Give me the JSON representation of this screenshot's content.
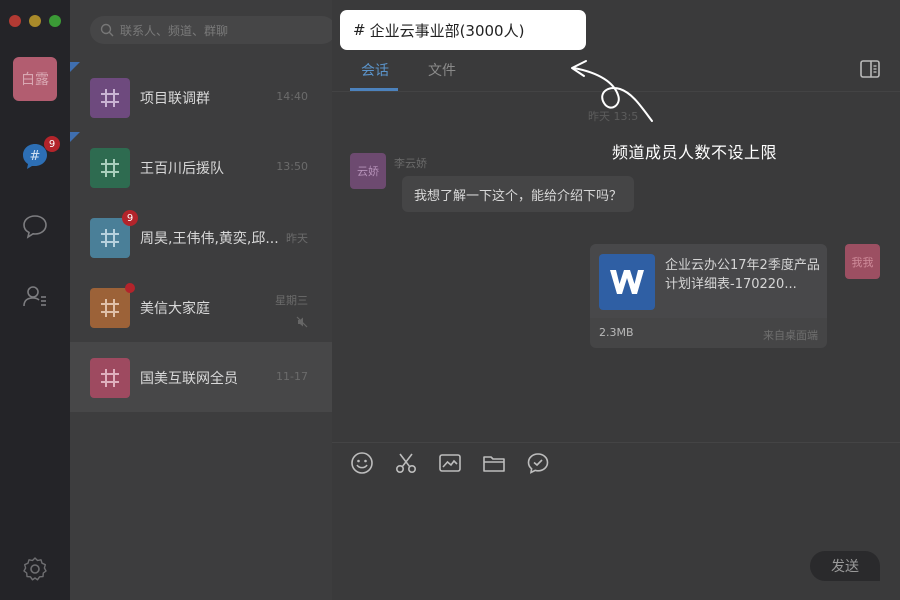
{
  "rail": {
    "user_avatar_text": "白露",
    "channel_badge": "9",
    "icons": [
      "channel-icon",
      "chat-bubble-icon",
      "contacts-icon",
      "settings-icon"
    ]
  },
  "search": {
    "placeholder": "联系人、频道、群聊"
  },
  "conversations": [
    {
      "name": "项目联调群",
      "time": "14:40",
      "color": "#7a4a8a",
      "pinned": true
    },
    {
      "name": "王百川后援队",
      "time": "13:50",
      "color": "#2e7a56",
      "pinned": true
    },
    {
      "name": "周昊,王伟伟,黄奕,邱...",
      "time": "昨天",
      "color": "#4b8fb0",
      "badge": "9"
    },
    {
      "name": "美信大家庭",
      "time": "星期三",
      "color": "#b8703a",
      "dot": true,
      "muted": true
    },
    {
      "name": "国美互联网全员",
      "time": "11-17",
      "color": "#b0506a",
      "active": true
    }
  ],
  "channel_title": {
    "hash": "#",
    "name": "企业云事业部(3000人)"
  },
  "tabs": {
    "chat": "会话",
    "files": "文件"
  },
  "messages": {
    "time_separator": "昨天 13:5",
    "incoming": {
      "sender": "李云娇",
      "avatar_text": "云娇",
      "text": "我想了解一下这个，能给介绍下吗？"
    },
    "file": {
      "name": "企业云办公17年2季度产品计划详细表-170220...",
      "size": "2.3MB",
      "source": "来自桌面端"
    },
    "me_avatar_text": "我我"
  },
  "annotation": {
    "text": "频道成员人数不设上限"
  },
  "composer": {
    "tools": [
      "emoji-icon",
      "scissors-icon",
      "image-icon",
      "folder-icon",
      "message-icon"
    ],
    "send_label": "发送"
  },
  "colors": {
    "accent_blue": "#4c82bd",
    "badge_red": "#b3242b",
    "rail_bg": "#242428"
  }
}
